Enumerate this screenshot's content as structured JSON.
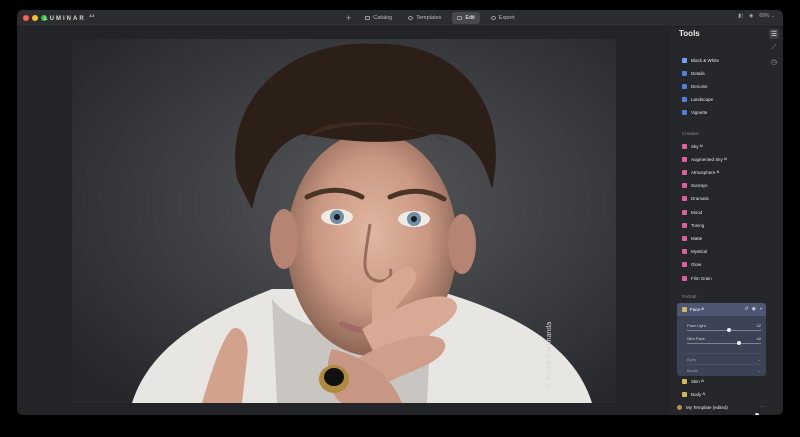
{
  "app": {
    "brand": "LUMINAR",
    "version": "4.3"
  },
  "window_controls": {
    "close_color": "#ff5f57",
    "minimize_color": "#febc2e",
    "zoom_color": "#28c840"
  },
  "nav": {
    "add_label": "+",
    "items": [
      {
        "label": "Catalog",
        "active": false
      },
      {
        "label": "Templates",
        "active": false
      },
      {
        "label": "Edit",
        "active": true
      },
      {
        "label": "Export",
        "active": false
      }
    ]
  },
  "toolbar_right": {
    "zoom": "69%"
  },
  "photo": {
    "watermark": "© Aiyush Pachnanda"
  },
  "panel": {
    "title": "Tools",
    "essentials": [
      {
        "label": "Black & White",
        "icon_color": "#6fa2ff"
      },
      {
        "label": "Details",
        "icon_color": "#4f7fe0"
      },
      {
        "label": "Denoise",
        "icon_color": "#4f7fe0"
      },
      {
        "label": "Landscape",
        "icon_color": "#4f7fe0"
      },
      {
        "label": "Vignette",
        "icon_color": "#4f7fe0"
      }
    ],
    "creative_label": "Creative",
    "creative": [
      {
        "label": "Sky ᴬᴵ",
        "icon_color": "#e45da1"
      },
      {
        "label": "Augmented Sky ᴬᴵ",
        "icon_color": "#e45da1"
      },
      {
        "label": "Atmosphere ᴬᴵ",
        "icon_color": "#e45da1"
      },
      {
        "label": "Sunrays",
        "icon_color": "#e45da1"
      },
      {
        "label": "Dramatic",
        "icon_color": "#e45da1"
      },
      {
        "label": "Mood",
        "icon_color": "#e45da1"
      },
      {
        "label": "Toning",
        "icon_color": "#e45da1"
      },
      {
        "label": "Matte",
        "icon_color": "#e45da1"
      },
      {
        "label": "Mystical",
        "icon_color": "#e45da1"
      },
      {
        "label": "Glow",
        "icon_color": "#e45da1"
      },
      {
        "label": "Film Grain",
        "icon_color": "#e45da1"
      }
    ],
    "portrait_label": "Portrait",
    "face": {
      "label": "Face ᴬᴵ",
      "sliders": [
        {
          "label": "Face Light",
          "value": "32",
          "fraction": 0.57
        },
        {
          "label": "Slim Face",
          "value": "42",
          "fraction": 0.7
        }
      ],
      "subsections": [
        "Eyes",
        "Mouth"
      ]
    },
    "portrait_more": [
      {
        "label": "Skin ᴬᴵ",
        "icon_color": "#d6b85a"
      },
      {
        "label": "Body ᴬᴵ",
        "icon_color": "#d6b85a"
      }
    ],
    "template": {
      "label": "My Template (edited)",
      "more": "⋯",
      "fraction": 1.0
    }
  }
}
